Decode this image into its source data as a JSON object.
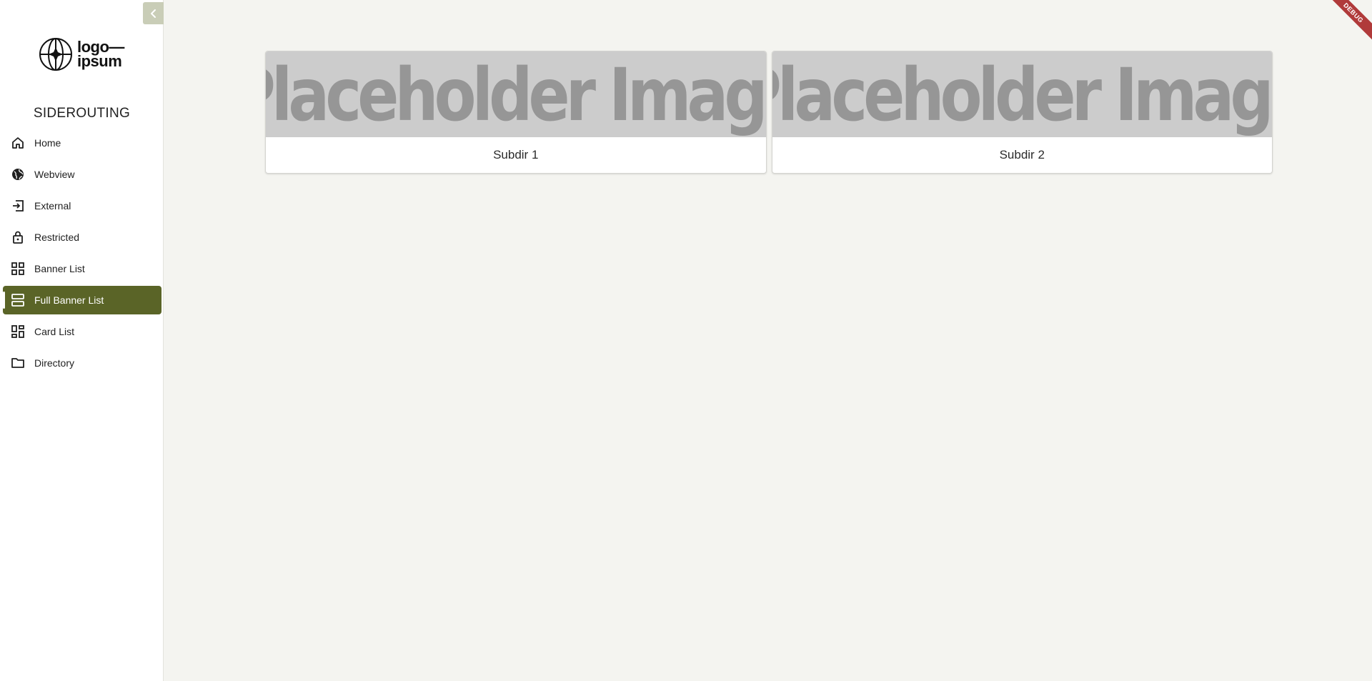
{
  "sidebar": {
    "logo_line1": "logo—",
    "logo_line2": "ipsum",
    "title": "SIDEROUTING",
    "items": [
      {
        "label": "Home",
        "icon": "home-icon"
      },
      {
        "label": "Webview",
        "icon": "globe-icon"
      },
      {
        "label": "External",
        "icon": "login-icon"
      },
      {
        "label": "Restricted",
        "icon": "lock-icon"
      },
      {
        "label": "Banner List",
        "icon": "grid-icon"
      },
      {
        "label": "Full Banner List",
        "icon": "rows-icon",
        "active": true
      },
      {
        "label": "Card List",
        "icon": "dashboard-icon"
      },
      {
        "label": "Directory",
        "icon": "folder-icon"
      }
    ]
  },
  "main": {
    "cards": [
      {
        "image_text": "Placeholder Image",
        "label": "Subdir 1"
      },
      {
        "image_text": "Placeholder Image",
        "label": "Subdir 2"
      }
    ]
  },
  "debug_banner": "DEBUG",
  "colors": {
    "accent": "#5a6427",
    "background": "#f4f4f0",
    "collapse_button": "#c9cdb7",
    "placeholder_bg": "#cccccc",
    "debug_ribbon": "#b03a3a"
  }
}
